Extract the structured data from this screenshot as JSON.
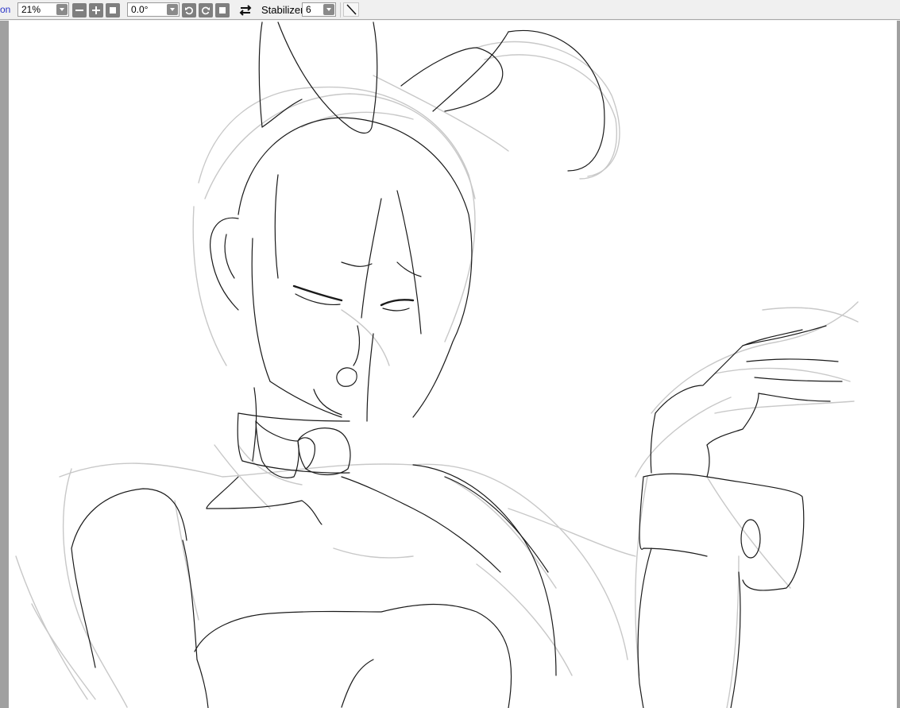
{
  "toolbar": {
    "cut_label": "on",
    "zoom": {
      "value": "21%"
    },
    "rotation": {
      "value": "0.0°"
    },
    "stabilizer": {
      "label": "Stabilizer",
      "value": "6"
    }
  },
  "icons": {
    "zoom_out": "minus-icon",
    "zoom_in": "plus-icon",
    "zoom_reset": "square-icon",
    "rotate_left": "rotate-left-icon",
    "rotate_right": "rotate-right-icon",
    "rotate_reset": "square-icon",
    "flip": "swap-arrows-icon",
    "line_tool": "diagonal-line-icon"
  },
  "colors": {
    "toolbar_bg": "#f0f0f0",
    "canvas_bg": "#ffffff",
    "rail": "#a0a0a0",
    "button": "#7f7f7f",
    "sketch_light": "#c8c8c8",
    "lineart": "#1a1a1a"
  }
}
